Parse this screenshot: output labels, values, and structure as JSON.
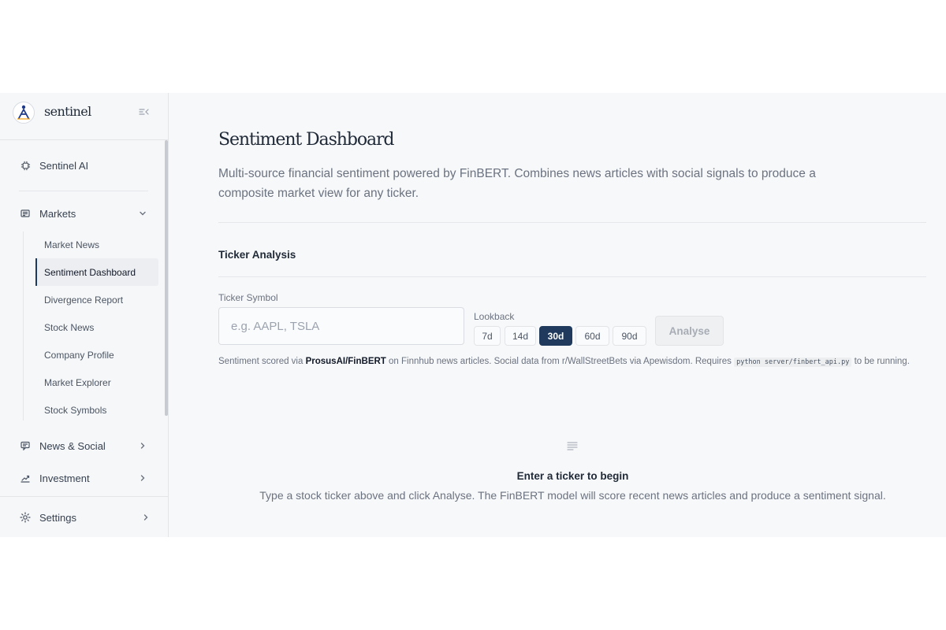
{
  "brand": {
    "name": "sentinel"
  },
  "sidebar": {
    "top_item": {
      "label": "Sentinel AI",
      "icon": "chip-icon"
    },
    "markets": {
      "label": "Markets",
      "icon": "newspaper-icon",
      "expanded": true,
      "items": [
        {
          "label": "Market News",
          "active": false
        },
        {
          "label": "Sentiment Dashboard",
          "active": true
        },
        {
          "label": "Divergence Report",
          "active": false
        },
        {
          "label": "Stock News",
          "active": false
        },
        {
          "label": "Company Profile",
          "active": false
        },
        {
          "label": "Market Explorer",
          "active": false
        },
        {
          "label": "Stock Symbols",
          "active": false
        }
      ]
    },
    "news_social": {
      "label": "News & Social",
      "icon": "message-icon"
    },
    "investment": {
      "label": "Investment",
      "icon": "trend-icon"
    },
    "settings": {
      "label": "Settings",
      "icon": "gear-icon"
    }
  },
  "main": {
    "title": "Sentiment Dashboard",
    "description": "Multi-source financial sentiment powered by FinBERT. Combines news articles with social signals to produce a composite market view for any ticker.",
    "section_title": "Ticker Analysis",
    "ticker_field": {
      "label": "Ticker Symbol",
      "placeholder": "e.g. AAPL, TSLA",
      "value": ""
    },
    "lookback": {
      "label": "Lookback",
      "options": [
        "7d",
        "14d",
        "30d",
        "60d",
        "90d"
      ],
      "selected": "30d"
    },
    "analyse_label": "Analyse",
    "help": {
      "prefix": "Sentiment scored via ",
      "model": "ProsusAI/FinBERT",
      "middle": " on Finnhub news articles. Social data from r/WallStreetBets via Apewisdom. Requires ",
      "code": "python server/finbert_api.py",
      "suffix": " to be running."
    },
    "empty_state": {
      "title": "Enter a ticker to begin",
      "description": "Type a stock ticker above and click Analyse. The FinBERT model will score recent news articles and produce a sentiment signal."
    }
  },
  "colors": {
    "accent": "#1f3a5c",
    "sidebar_bg": "#f6f7f8",
    "main_bg": "#f7f8f9"
  }
}
